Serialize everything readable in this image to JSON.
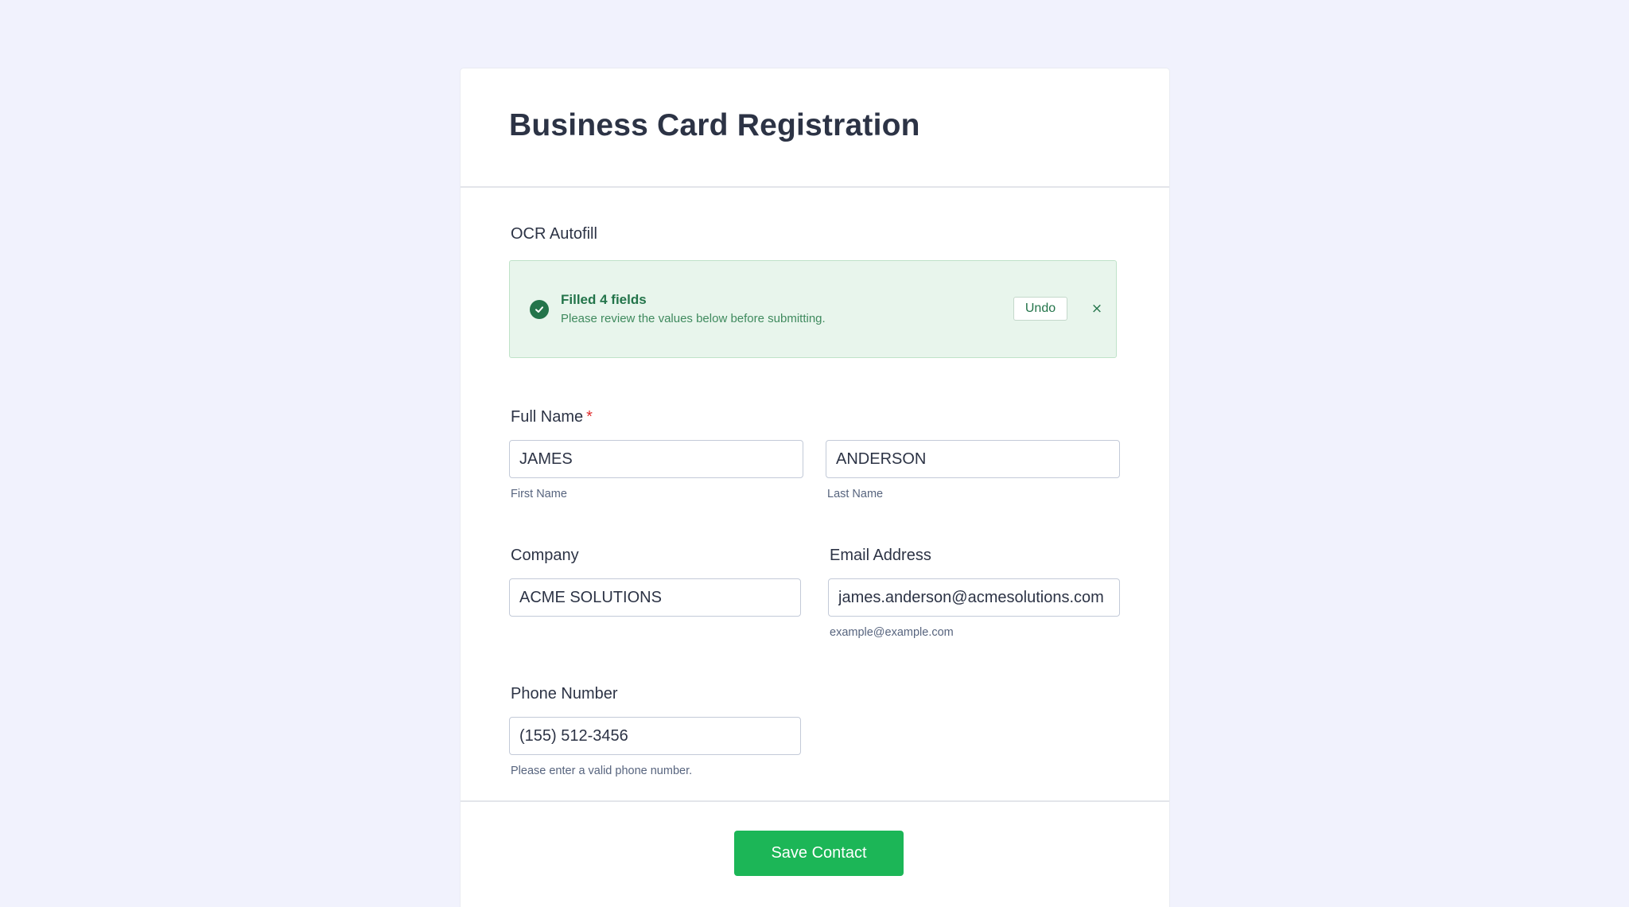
{
  "form": {
    "title": "Business Card Registration"
  },
  "ocr": {
    "label": "OCR Autofill",
    "alert_title": "Filled 4 fields",
    "alert_message": "Please review the values below before submitting.",
    "undo_label": "Undo",
    "close_glyph": "×",
    "icon": "check-circle-icon",
    "accent_color": "#23744a",
    "background_color": "#e8f5ec"
  },
  "full_name": {
    "label": "Full Name",
    "required_mark": "*",
    "first_value": "JAMES",
    "first_sublabel": "First Name",
    "last_value": "ANDERSON",
    "last_sublabel": "Last Name"
  },
  "company": {
    "label": "Company",
    "value": "ACME SOLUTIONS"
  },
  "email": {
    "label": "Email Address",
    "value": "james.anderson@acmesolutions.com",
    "sublabel": "example@example.com"
  },
  "phone": {
    "label": "Phone Number",
    "value": "(155) 512-3456",
    "sublabel": "Please enter a valid phone number."
  },
  "actions": {
    "save_label": "Save Contact",
    "save_color": "#1cb657"
  }
}
